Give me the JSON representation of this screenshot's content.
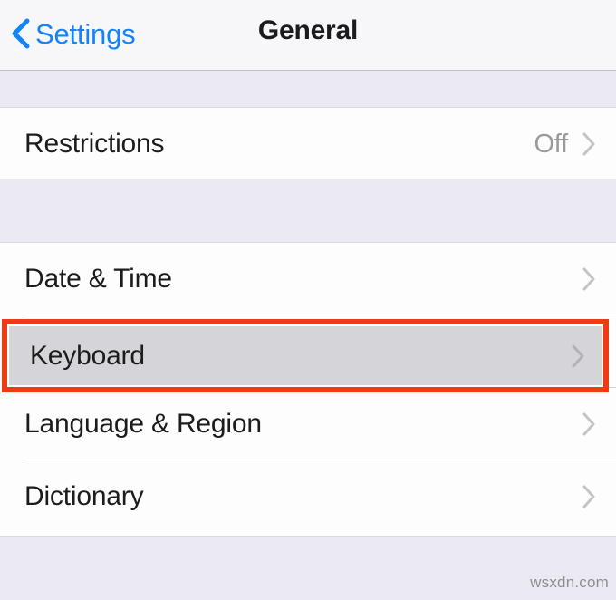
{
  "navbar": {
    "back_label": "Settings",
    "back_icon": "chevron-left-icon",
    "title": "General",
    "accent_color": "#1383fb",
    "background_color": "#f7f7f9"
  },
  "groups": [
    {
      "name": "restrictions-group",
      "rows": [
        {
          "label": "Restrictions",
          "value": "Off",
          "disclosure": "chevron-right-icon",
          "selected": false
        }
      ]
    },
    {
      "name": "general-settings-group",
      "rows": [
        {
          "label": "Date & Time",
          "value": "",
          "disclosure": "chevron-right-icon",
          "selected": false
        },
        {
          "label": "Keyboard",
          "value": "",
          "disclosure": "chevron-right-icon",
          "selected": true
        },
        {
          "label": "Language & Region",
          "value": "",
          "disclosure": "chevron-right-icon",
          "selected": false
        },
        {
          "label": "Dictionary",
          "value": "",
          "disclosure": "chevron-right-icon",
          "selected": false
        }
      ]
    }
  ],
  "highlight": {
    "target_label": "Keyboard",
    "border_color": "#f03a13",
    "fill_color": "#d5d4d8"
  },
  "watermark": {
    "text": "wsxdn.com"
  },
  "colors": {
    "page_background": "#ebe9f2",
    "row_background": "#fdfdfd",
    "separator": "#d3d3d8",
    "label_text": "#1c1c1e",
    "value_text": "#9a9a9e",
    "chevron": "#c4c4c8"
  }
}
